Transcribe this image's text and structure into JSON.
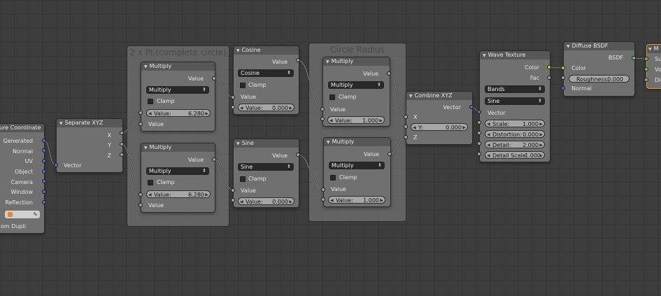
{
  "frames": {
    "circle": "2 x PI (complete circle)",
    "radius": "Circle Radius"
  },
  "texcoord": {
    "title": "ure Coordinate",
    "outputs": [
      "Generated",
      "Normal",
      "UV",
      "Object",
      "Camera",
      "Window",
      "Reflection"
    ],
    "footer": "om Dupli"
  },
  "sepxyz": {
    "title": "Separate XYZ",
    "outputs": [
      "X",
      "Y",
      "Z"
    ],
    "input": "Vector"
  },
  "mult1": {
    "title": "Multiply",
    "out": "Value",
    "op": "Multiply",
    "clamp": "Clamp",
    "param": "Value:",
    "value": "6.280",
    "in": "Value"
  },
  "mult2": {
    "title": "Multiply",
    "out": "Value",
    "op": "Multiply",
    "clamp": "Clamp",
    "param": "Value:",
    "value": "6.280",
    "in": "Value"
  },
  "cosine": {
    "title": "Cosine",
    "out": "Value",
    "op": "Cosine",
    "clamp": "Clamp",
    "in": "Value",
    "param": "Value:",
    "value": "0.000"
  },
  "sine": {
    "title": "Sine",
    "out": "Value",
    "op": "Sine",
    "clamp": "Clamp",
    "in": "Value",
    "param": "Value:",
    "value": "0.000"
  },
  "mult3": {
    "title": "Multiply",
    "out": "Value",
    "op": "Multiply",
    "clamp": "Clamp",
    "in": "Value",
    "param": "Value:",
    "value": "1.000"
  },
  "mult4": {
    "title": "Multiply",
    "out": "Value",
    "op": "Multiply",
    "clamp": "Clamp",
    "in": "Value",
    "param": "Value:",
    "value": "1.000"
  },
  "combine": {
    "title": "Combine XYZ",
    "out": "Vector",
    "x": "X",
    "y_param": "Y:",
    "y_value": "0.000",
    "z": "Z"
  },
  "wave": {
    "title": "Wave Texture",
    "out_color": "Color",
    "out_fac": "Fac",
    "type": "Bands",
    "profile": "Sine",
    "in_vector": "Vector",
    "scale_label": "Scale:",
    "scale": "1.000",
    "distortion_label": "Distortion:",
    "distortion": "0.000",
    "detail_label": "Detail:",
    "detail": "2.000",
    "detail_scale_label": "Detail Scale",
    "detail_scale": "1.000"
  },
  "diffuse": {
    "title": "Diffuse BSDF",
    "out": "BSDF",
    "color": "Color",
    "rough_label": "Roughness:",
    "rough_value": "0.000",
    "normal": "Normal"
  },
  "output": {
    "title": "M",
    "in1": "Su",
    "in2": "Vo",
    "in3": "Di"
  },
  "colors": {
    "value_socket": "#a1a1a1",
    "vector_socket": "#6363c7",
    "color_socket": "#c7c729",
    "shader_socket": "#63c763",
    "selected_outline": "#e8922e"
  }
}
